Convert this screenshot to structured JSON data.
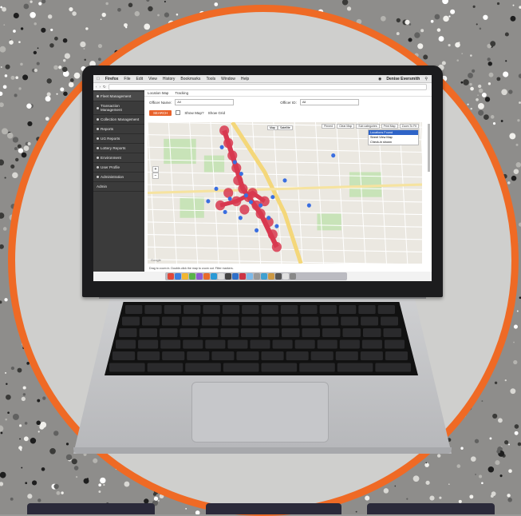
{
  "colors": {
    "ring": "#ef6a25",
    "disc": "#cfcfcd",
    "sidebar": "#3b3b3b",
    "search_button": "#e8612a",
    "selected_option": "#2f64c7",
    "route_red": "#d8384f",
    "point_blue": "#3a6ee0"
  },
  "menubar": {
    "apple_icon": "apple-icon",
    "app_name": "Firefox",
    "items": [
      "File",
      "Edit",
      "View",
      "History",
      "Bookmarks",
      "Tools",
      "Window",
      "Help"
    ],
    "user": "Denise Eversmith"
  },
  "sidebar": {
    "items": [
      {
        "label": "Fleet Management",
        "active": true
      },
      {
        "label": "Transaction Management"
      },
      {
        "label": "Collection Management"
      },
      {
        "label": "Reports"
      },
      {
        "label": "UG Reports"
      },
      {
        "label": "Lottery Reports"
      },
      {
        "label": "Environment"
      },
      {
        "label": "User Profile"
      },
      {
        "label": "Administration"
      },
      {
        "label": "Admin"
      }
    ]
  },
  "main": {
    "tabs": [
      "Location Map",
      "Tracking"
    ],
    "officer_name_label": "Officer Name:",
    "officer_name_value": "All",
    "officer_id_label": "Officer ID:",
    "officer_id_value": "All",
    "search_button": "SEARCH",
    "show_map_label": "Show Map?",
    "show_grid_label": "Show Grid"
  },
  "map": {
    "type_buttons": [
      "Map",
      "Satellite"
    ],
    "toolbar": [
      "Pinned",
      "Clear Map",
      "Sub categories",
      "Print Map",
      "Zoom To Fit"
    ],
    "dropdown": [
      {
        "label": "Locations Found",
        "selected": true
      },
      {
        "label": "Street View Map"
      },
      {
        "label": "Check-in shown"
      }
    ],
    "zoom": [
      "+",
      "−"
    ],
    "google_label": "Google",
    "caption": "Drag to zoom in. Double-click the map to zoom out. Filter markers."
  }
}
